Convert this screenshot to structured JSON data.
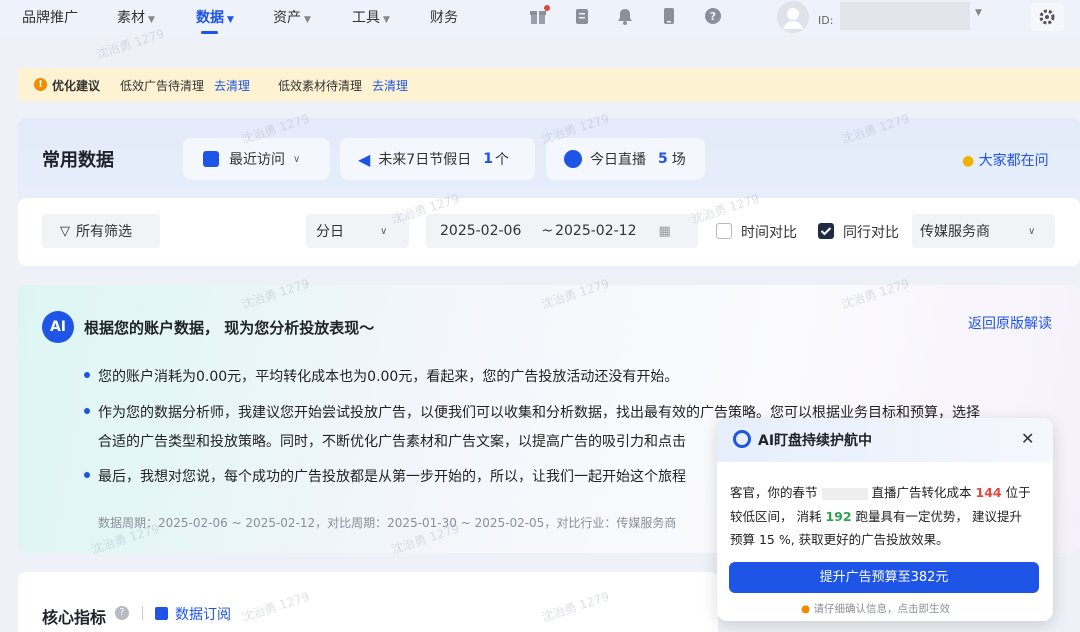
{
  "nav": {
    "items": [
      {
        "label": "品牌推广",
        "caret": false
      },
      {
        "label": "素材",
        "caret": true
      },
      {
        "label": "数据",
        "caret": true,
        "active": true
      },
      {
        "label": "资产",
        "caret": true
      },
      {
        "label": "工具",
        "caret": true
      },
      {
        "label": "财务",
        "caret": false
      }
    ],
    "user_id_label": "ID:"
  },
  "notice": {
    "title": "优化建议",
    "item1_text": "低效广告待清理",
    "item1_link": "去清理",
    "item2_text": "低效素材待清理",
    "item2_link": "去清理"
  },
  "common": {
    "title": "常用数据",
    "recent": "最近访问",
    "holiday": "未来7日节假日",
    "holiday_count": "1",
    "holiday_unit": "个",
    "live": "今日直播",
    "live_count": "5",
    "live_unit": "场",
    "ask": "大家都在问"
  },
  "filters": {
    "all_filter": "所有筛选",
    "granularity": "分日",
    "date_start": "2025-02-06",
    "date_sep": "~",
    "date_end": "2025-02-12",
    "time_compare": "时间对比",
    "peer_compare": "同行对比",
    "peer_compare_checked": true,
    "industry": "传媒服务商"
  },
  "ai": {
    "badge": "AI",
    "heading": "根据您的账户数据， 现为您分析投放表现～",
    "back_link": "返回原版解读",
    "p1": "您的账户消耗为0.00元，平均转化成本也为0.00元，看起来，您的广告投放活动还没有开始。",
    "p2_line1": "作为您的数据分析师，我建议您开始尝试投放广告，以便我们可以收集和分析数据，找出最有效的广告策略。您可以根据业务目标和预算，选择",
    "p2_line2": "合适的广告类型和投放策略。同时，不断优化广告素材和广告文案，以提高广告的吸引力和点击",
    "p3": "最后，我想对您说，每个成功的广告投放都是从第一步开始的，所以，让我们一起开始这个旅程",
    "footer": "数据周期：2025-02-06 ~ 2025-02-12，对比周期：2025-01-30 ~ 2025-02-05，对比行业：传媒服务商"
  },
  "popup": {
    "title": "AI盯盘持续护航中",
    "line1_a": "客官，你的春节",
    "line1_b": "直播广告转化成本",
    "value1": "144",
    "line1_c": "位于",
    "line2_a": "较低区间， 消耗",
    "value2": "192",
    "line2_b": "跑量具有一定优势， 建议提升",
    "line3": "预算 15 %, 获取更好的广告投放效果。",
    "cta": "提升广告预算至382元",
    "tip": "请仔细确认信息，点击即生效"
  },
  "core": {
    "title": "核心指标",
    "subscribe": "数据订阅"
  },
  "watermark": "沈治勇 1279",
  "colors": {
    "accent": "#1f55e6",
    "red": "#e5483a",
    "green": "#2ea44f",
    "notice_bg": "#fdf2d2"
  }
}
